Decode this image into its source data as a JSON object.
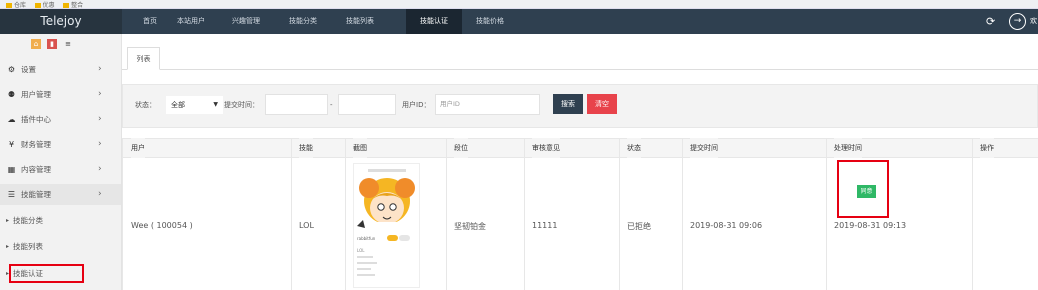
{
  "bookmarks": [
    "仓库",
    "优惠",
    "整合"
  ],
  "brand": "Telejoy",
  "nav": [
    {
      "label": "首页",
      "active": false
    },
    {
      "label": "本站用户",
      "active": false
    },
    {
      "label": "兴趣管理",
      "active": false
    },
    {
      "label": "技能分类",
      "active": false
    },
    {
      "label": "技能列表",
      "active": false
    },
    {
      "label": "技能认证",
      "active": true
    },
    {
      "label": "技能价格",
      "active": false
    }
  ],
  "top_right": {
    "refresh_icon": "refresh-icon",
    "exit_icon": "logout-icon",
    "welcome": "欢"
  },
  "sidebar": {
    "quick_buttons": [
      {
        "icon": "home-icon",
        "color": "#f0ad4e"
      },
      {
        "icon": "trash-icon",
        "color": "#d9534f"
      },
      {
        "icon": "list-icon",
        "color": "#f2f2f2"
      }
    ],
    "items": [
      {
        "icon": "gear-icon",
        "label": "设置",
        "glyph": "⚙"
      },
      {
        "icon": "users-icon",
        "label": "用户管理",
        "glyph": "👥"
      },
      {
        "icon": "cloud-icon",
        "label": "插件中心",
        "glyph": "☁"
      },
      {
        "icon": "yen-icon",
        "label": "财务管理",
        "glyph": "¥"
      },
      {
        "icon": "grid-icon",
        "label": "内容管理",
        "glyph": "▦"
      },
      {
        "icon": "menu-icon",
        "label": "技能管理",
        "glyph": "☰"
      }
    ],
    "sub_items": [
      "技能分类",
      "技能列表",
      "技能认证"
    ]
  },
  "tab": "列表",
  "search": {
    "status_label": "状态：",
    "status_value": "全部",
    "time_label": "提交时间：",
    "range_sep": "-",
    "uid_label": "用户ID：",
    "uid_placeholder": "用户ID",
    "search_btn": "搜索",
    "clear_btn": "清空"
  },
  "table": {
    "headers": [
      "用户",
      "技能",
      "截图",
      "段位",
      "审核意见",
      "状态",
      "提交时间",
      "处理时间",
      "操作"
    ],
    "row": {
      "user": "Wee ( 100054 )",
      "skill": "LOL",
      "rank": "坚韧铂金",
      "opinion": "11111",
      "status": "已拒绝",
      "submit_time": "2019-08-31 09:06",
      "handle_time": "2019-08-31 09:13",
      "action": "同意"
    }
  },
  "screenshot_text": {
    "name": "rabbitfun",
    "label": "LOL"
  },
  "colors": {
    "topbar": "#2f4050",
    "search_btn": "#2f4050",
    "clear_btn": "#e8434b",
    "agree_btn": "#2fb866",
    "highlight": "#e60012"
  }
}
